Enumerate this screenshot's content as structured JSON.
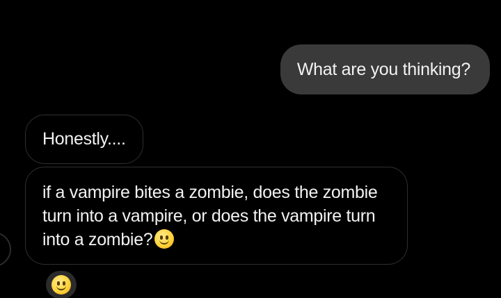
{
  "chat": {
    "messages": [
      {
        "direction": "outgoing",
        "text": "What are you thinking?"
      },
      {
        "direction": "incoming",
        "text": "Honestly...."
      },
      {
        "direction": "incoming",
        "text": "if a vampire bites a zombie, does the zombie turn into a vampire, or does the vampire turn into a zombie?",
        "emoji": "smiling-face-icon"
      }
    ],
    "reaction": {
      "emoji": "smiling-face-icon"
    }
  },
  "colors": {
    "background": "#000000",
    "outgoing_bubble": "#3a3a3a",
    "incoming_border": "#2f2f2f",
    "text": "#f2f2f2"
  }
}
